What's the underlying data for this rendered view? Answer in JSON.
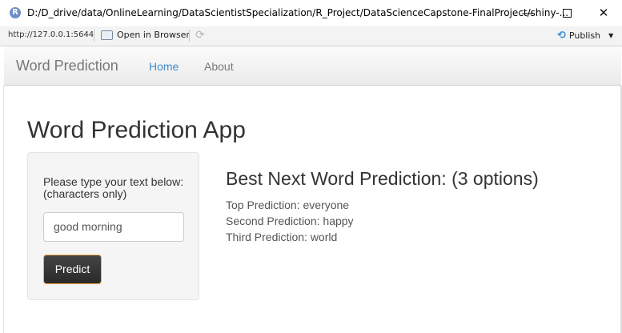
{
  "window": {
    "title": "D:/D_drive/data/OnlineLearning/DataScientistSpecialization/R_Project/DataScienceCapstone-FinalProject/shiny-...",
    "app_icon_letter": "R",
    "minimize": "—",
    "close": "✕"
  },
  "toolbar": {
    "url": "http://127.0.0.1:5644",
    "open_in_browser": "Open in Browser",
    "refresh_icon": "⟳",
    "publish": "Publish",
    "publish_caret": "▼",
    "publish_icon": "⟲"
  },
  "navbar": {
    "brand": "Word Prediction",
    "tabs": [
      {
        "label": "Home",
        "active": true
      },
      {
        "label": "About",
        "active": false
      }
    ]
  },
  "main": {
    "title": "Word Prediction App",
    "sidebar": {
      "label": "Please type your text below: (characters only)",
      "input_value": "good morning",
      "button_label": "Predict"
    },
    "result": {
      "heading": "Best Next Word Prediction: (3 options)",
      "lines": [
        "Top Prediction: everyone",
        "Second Prediction: happy",
        "Third Prediction: world"
      ]
    }
  },
  "colors": {
    "accent": "#428bca",
    "button_bg": "#333333",
    "button_border": "#f0ad4e"
  }
}
